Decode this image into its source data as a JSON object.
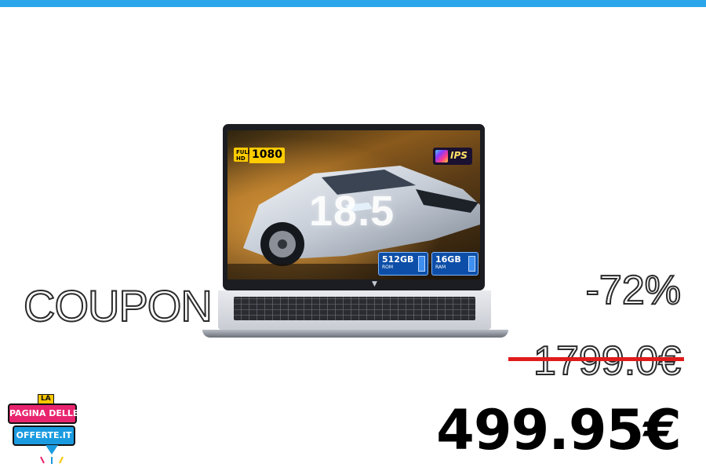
{
  "colors": {
    "top_bar": "#2ba6ea",
    "strike": "#e01b1b",
    "price": "#000000"
  },
  "product": {
    "screen_badges": {
      "full_hd": "FULL HD",
      "resolution": "1080",
      "panel": "IPS"
    },
    "screen_size": "18.5",
    "storage": {
      "value": "512GB",
      "label": "ROM"
    },
    "ram": {
      "value": "16GB",
      "label": "RAM"
    },
    "icons": [
      "sports-car-image",
      "keyboard",
      "chip-icon"
    ]
  },
  "promo": {
    "coupon_label": "COUPON",
    "discount": "-72%",
    "old_price": "1799.0€",
    "new_price": "499.95€"
  },
  "brand": {
    "prefix": "LA",
    "line1": "PAGINA DELLE",
    "line2": "OFFERTE.IT"
  }
}
